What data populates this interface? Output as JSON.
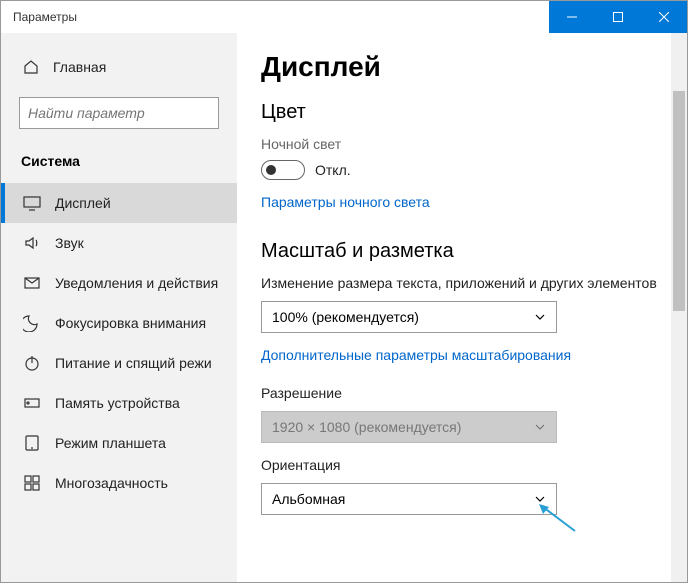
{
  "window": {
    "title": "Параметры"
  },
  "sidebar": {
    "home": "Главная",
    "search_placeholder": "Найти параметр",
    "category": "Система",
    "items": [
      {
        "label": "Дисплей"
      },
      {
        "label": "Звук"
      },
      {
        "label": "Уведомления и действия"
      },
      {
        "label": "Фокусировка внимания"
      },
      {
        "label": "Питание и спящий режи"
      },
      {
        "label": "Память устройства"
      },
      {
        "label": "Режим планшета"
      },
      {
        "label": "Многозадачность"
      }
    ]
  },
  "main": {
    "title": "Дисплей",
    "color": {
      "heading": "Цвет",
      "night_light_label": "Ночной свет",
      "night_light_state": "Откл.",
      "night_light_link": "Параметры ночного света"
    },
    "scale": {
      "heading": "Масштаб и разметка",
      "text_size_label": "Изменение размера текста, приложений и других элементов",
      "text_size_value": "100% (рекомендуется)",
      "advanced_link": "Дополнительные параметры масштабирования",
      "resolution_label": "Разрешение",
      "resolution_value": "1920 × 1080 (рекомендуется)",
      "orientation_label": "Ориентация",
      "orientation_value": "Альбомная"
    }
  },
  "colors": {
    "accent": "#0078d7",
    "link": "#0066cc"
  }
}
